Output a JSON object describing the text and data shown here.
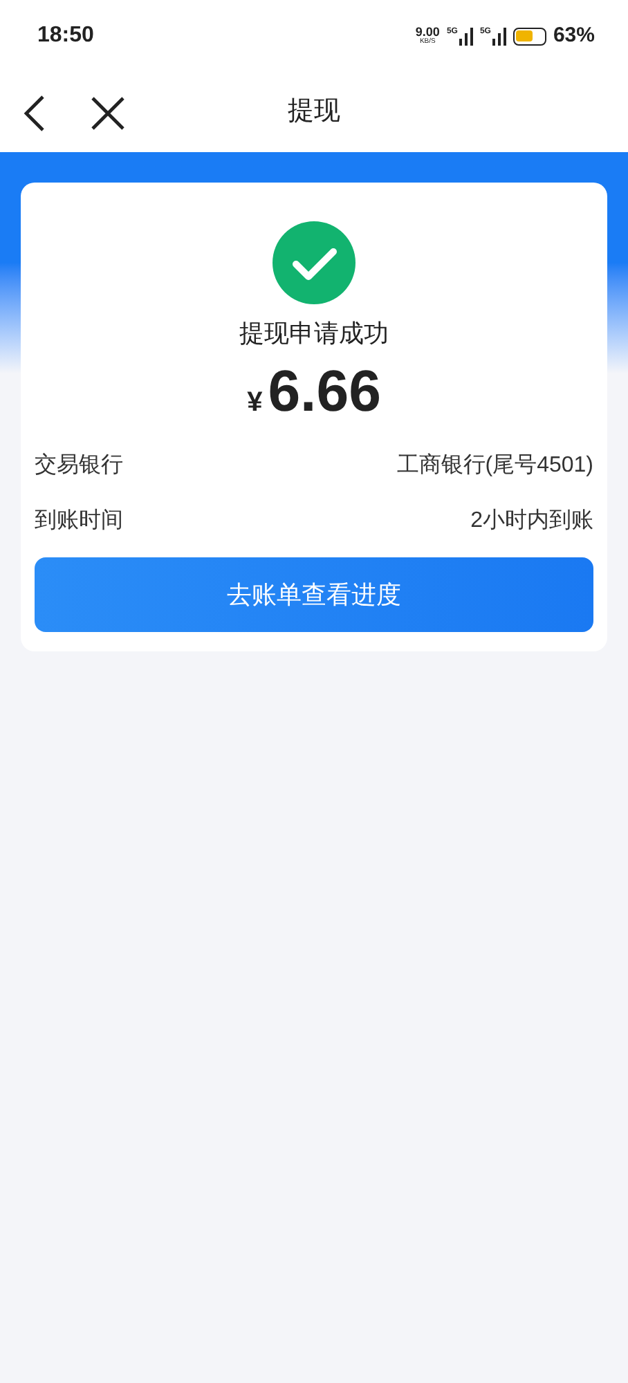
{
  "status_bar": {
    "time": "18:50",
    "net_speed": "9.00",
    "net_speed_unit": "KB/S",
    "signals": [
      {
        "network": "5G"
      },
      {
        "network": "5G"
      }
    ],
    "battery": {
      "percent": "63%"
    }
  },
  "nav": {
    "title": "提现"
  },
  "result": {
    "message": "提现申请成功",
    "currency": "¥",
    "amount": "6.66"
  },
  "details": [
    {
      "label": "交易银行",
      "value": "工商银行(尾号4501)"
    },
    {
      "label": "到账时间",
      "value": "2小时内到账"
    }
  ],
  "button": {
    "label": "去账单查看进度"
  }
}
